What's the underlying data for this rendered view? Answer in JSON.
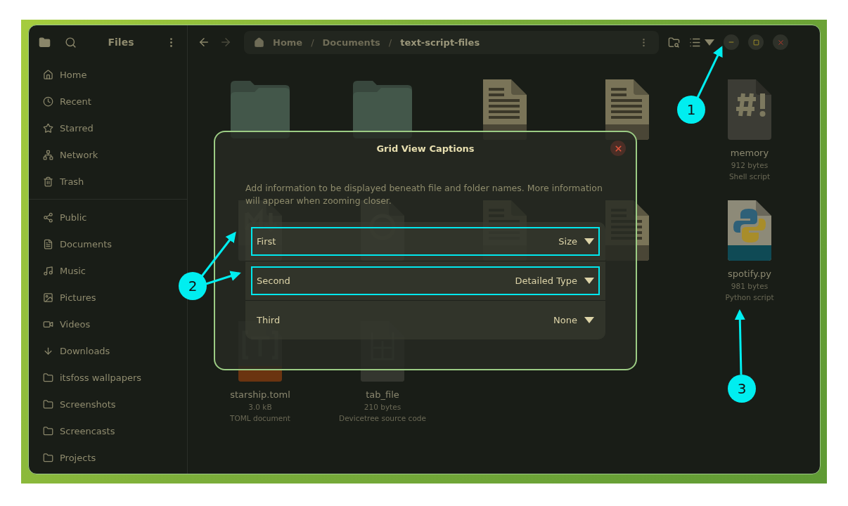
{
  "sidebar": {
    "title": "Files",
    "places": [
      {
        "label": "Home",
        "kind": "home",
        "selected": false
      },
      {
        "label": "Recent",
        "kind": "recent",
        "selected": false
      },
      {
        "label": "Starred",
        "kind": "star",
        "selected": false
      },
      {
        "label": "Network",
        "kind": "network",
        "selected": false
      },
      {
        "label": "Trash",
        "kind": "trash",
        "selected": false
      }
    ],
    "bookmarks": [
      {
        "label": "Public",
        "kind": "share",
        "selected": false
      },
      {
        "label": "Documents",
        "kind": "document",
        "selected": false
      },
      {
        "label": "Music",
        "kind": "music",
        "selected": false
      },
      {
        "label": "Pictures",
        "kind": "image",
        "selected": false
      },
      {
        "label": "Videos",
        "kind": "video",
        "selected": false
      },
      {
        "label": "Downloads",
        "kind": "download",
        "selected": false
      },
      {
        "label": "itsfoss wallpapers",
        "kind": "folder",
        "selected": false
      },
      {
        "label": "Screenshots",
        "kind": "folder",
        "selected": false
      },
      {
        "label": "Screencasts",
        "kind": "folder",
        "selected": false
      },
      {
        "label": "Projects",
        "kind": "folder",
        "selected": false
      }
    ]
  },
  "path": [
    {
      "kind": "segment",
      "label": "Home"
    },
    {
      "kind": "separator",
      "label": "/"
    },
    {
      "kind": "segment",
      "label": "Documents"
    },
    {
      "kind": "separator",
      "label": "/"
    },
    {
      "kind": "segment",
      "label": "text-script-files"
    }
  ],
  "files": [
    {
      "kind": "folder"
    },
    {
      "kind": "folder"
    },
    {
      "kind": "txt"
    },
    {
      "kind": "txt"
    },
    {
      "kind": "script",
      "name": "memory",
      "size": "912 bytes",
      "type": "Shell script"
    },
    {
      "kind": "markdown"
    },
    {
      "kind": "json"
    },
    {
      "kind": "txt"
    },
    {
      "kind": "txt"
    },
    {
      "kind": "python",
      "name": "spotify.py",
      "size": "981 bytes",
      "type": "Python script"
    },
    {
      "kind": "toml",
      "name": "starship.toml",
      "size": "3.0 kB",
      "type": "TOML document"
    },
    {
      "kind": "dts",
      "name": "tab_file",
      "size": "210 bytes",
      "type": "Devicetree source code"
    }
  ],
  "dialog": {
    "title": "Grid View Captions",
    "description": "Add information to be displayed beneath file and folder names. More information will appear when zooming closer.",
    "captions": [
      {
        "label": "First",
        "value": "Size",
        "highlighted": true
      },
      {
        "label": "Second",
        "value": "Detailed Type",
        "highlighted": true
      },
      {
        "label": "Third",
        "value": "None",
        "highlighted": false
      }
    ]
  },
  "annotations": [
    {
      "number": "1"
    },
    {
      "number": "2"
    },
    {
      "number": "3"
    }
  ]
}
